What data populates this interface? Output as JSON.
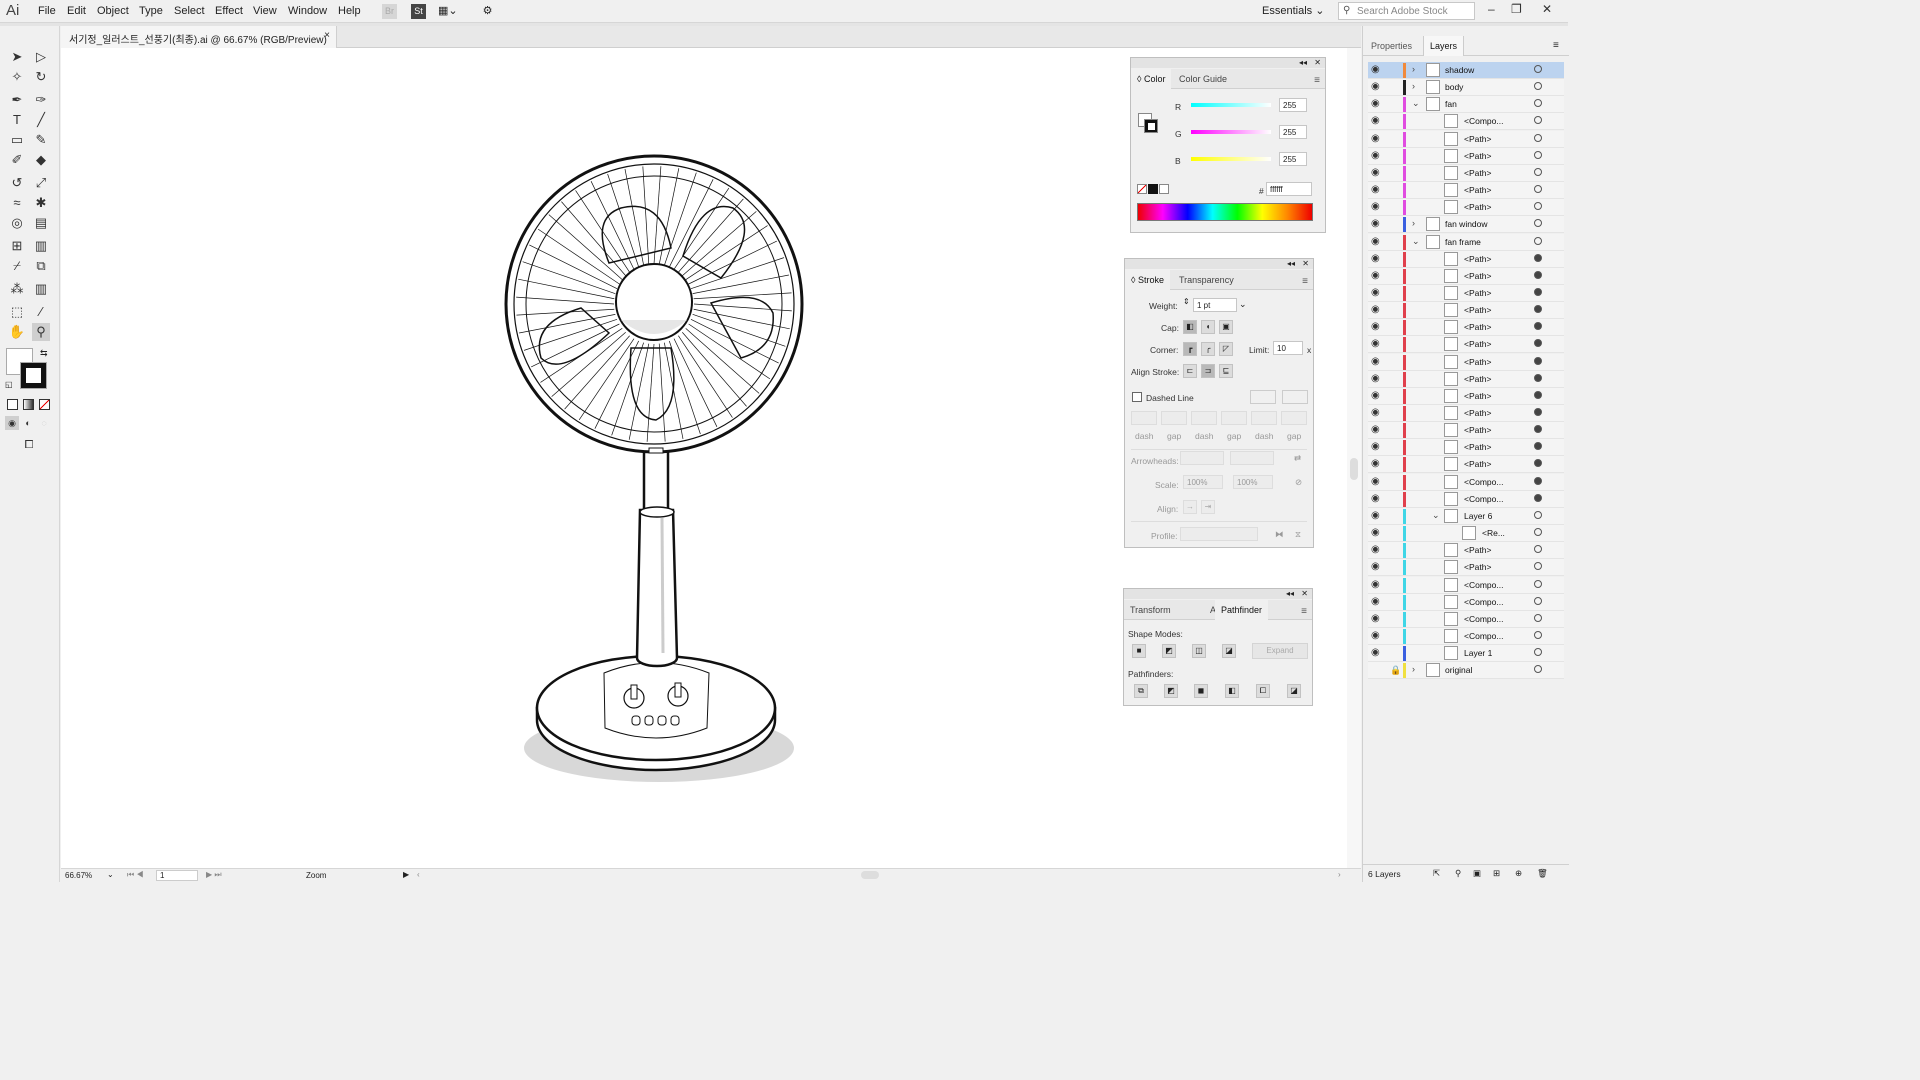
{
  "app": {
    "logo": "Ai"
  },
  "menu": [
    "File",
    "Edit",
    "Object",
    "Type",
    "Select",
    "Effect",
    "View",
    "Window",
    "Help"
  ],
  "menubar_icons": {
    "bridge": "Br",
    "stock": "St"
  },
  "workspace": "Essentials",
  "search_stock_placeholder": "Search Adobe Stock",
  "document_tab": {
    "title": "서기정_일러스트_선풍기(최종).ai @ 66.67% (RGB/Preview)",
    "close": "×"
  },
  "status": {
    "zoom": "66.67%",
    "page": "1",
    "tool_label": "Zoom"
  },
  "color_panel": {
    "tabs": [
      "Color",
      "Color Guide"
    ],
    "channels": [
      {
        "label": "R",
        "value": "255"
      },
      {
        "label": "G",
        "value": "255"
      },
      {
        "label": "B",
        "value": "255"
      }
    ],
    "hex_label": "#",
    "hex": "ffffff"
  },
  "stroke_panel": {
    "tabs": [
      "Stroke",
      "Transparency"
    ],
    "weight_label": "Weight:",
    "weight": "1 pt",
    "cap_label": "Cap:",
    "corner_label": "Corner:",
    "limit_label": "Limit:",
    "limit": "10",
    "limit_unit": "x",
    "align_label": "Align Stroke:",
    "dashed_label": "Dashed Line",
    "dash_labels": [
      "dash",
      "gap",
      "dash",
      "gap",
      "dash",
      "gap"
    ],
    "arrowheads_label": "Arrowheads:",
    "scale_label": "Scale:",
    "scale_values": [
      "100%",
      "100%"
    ],
    "align2_label": "Align:",
    "profile_label": "Profile:"
  },
  "pathfinder_panel": {
    "tabs": [
      "Transform",
      "Align",
      "Pathfinder"
    ],
    "shape_modes_label": "Shape Modes:",
    "expand_label": "Expand",
    "pathfinders_label": "Pathfinders:"
  },
  "right_panel": {
    "tabs": [
      "Properties",
      "Layers"
    ]
  },
  "layers": [
    {
      "name": "shadow",
      "depth": 0,
      "arrow": "›",
      "color": "#f08a3c",
      "selected": true
    },
    {
      "name": "body",
      "depth": 0,
      "arrow": "›",
      "color": "#222222"
    },
    {
      "name": "fan",
      "depth": 0,
      "arrow": "⌄",
      "color": "#e04ce0"
    },
    {
      "name": "<Compo...",
      "depth": 1,
      "color": "#e04ce0"
    },
    {
      "name": "<Path>",
      "depth": 1,
      "color": "#e04ce0"
    },
    {
      "name": "<Path>",
      "depth": 1,
      "color": "#e04ce0"
    },
    {
      "name": "<Path>",
      "depth": 1,
      "color": "#e04ce0"
    },
    {
      "name": "<Path>",
      "depth": 1,
      "color": "#e04ce0"
    },
    {
      "name": "<Path>",
      "depth": 1,
      "color": "#e04ce0"
    },
    {
      "name": "fan window",
      "depth": 0,
      "arrow": "›",
      "color": "#3a5fe0"
    },
    {
      "name": "fan frame",
      "depth": 0,
      "arrow": "⌄",
      "color": "#e0404c"
    },
    {
      "name": "<Path>",
      "depth": 1,
      "color": "#e0404c"
    },
    {
      "name": "<Path>",
      "depth": 1,
      "color": "#e0404c"
    },
    {
      "name": "<Path>",
      "depth": 1,
      "color": "#e0404c"
    },
    {
      "name": "<Path>",
      "depth": 1,
      "color": "#e0404c"
    },
    {
      "name": "<Path>",
      "depth": 1,
      "color": "#e0404c"
    },
    {
      "name": "<Path>",
      "depth": 1,
      "color": "#e0404c"
    },
    {
      "name": "<Path>",
      "depth": 1,
      "color": "#e0404c"
    },
    {
      "name": "<Path>",
      "depth": 1,
      "color": "#e0404c"
    },
    {
      "name": "<Path>",
      "depth": 1,
      "color": "#e0404c"
    },
    {
      "name": "<Path>",
      "depth": 1,
      "color": "#e0404c"
    },
    {
      "name": "<Path>",
      "depth": 1,
      "color": "#e0404c"
    },
    {
      "name": "<Path>",
      "depth": 1,
      "color": "#e0404c"
    },
    {
      "name": "<Path>",
      "depth": 1,
      "color": "#e0404c"
    },
    {
      "name": "<Compo...",
      "depth": 1,
      "color": "#e0404c"
    },
    {
      "name": "<Compo...",
      "depth": 1,
      "color": "#e0404c"
    },
    {
      "name": "Layer 6",
      "depth": 1,
      "arrow": "⌄",
      "color": "#3fd6e6"
    },
    {
      "name": "<Re...",
      "depth": 2,
      "color": "#3fd6e6"
    },
    {
      "name": "<Path>",
      "depth": 1,
      "color": "#3fd6e6"
    },
    {
      "name": "<Path>",
      "depth": 1,
      "color": "#3fd6e6"
    },
    {
      "name": "<Compo...",
      "depth": 1,
      "color": "#3fd6e6"
    },
    {
      "name": "<Compo...",
      "depth": 1,
      "color": "#3fd6e6"
    },
    {
      "name": "<Compo...",
      "depth": 1,
      "color": "#3fd6e6"
    },
    {
      "name": "<Compo...",
      "depth": 1,
      "color": "#3fd6e6"
    },
    {
      "name": "Layer 1",
      "depth": 1,
      "color": "#3a5fe0"
    },
    {
      "name": "original",
      "depth": 0,
      "arrow": "›",
      "color": "#f0e040",
      "locked": true
    }
  ],
  "layers_footer": "6 Layers"
}
